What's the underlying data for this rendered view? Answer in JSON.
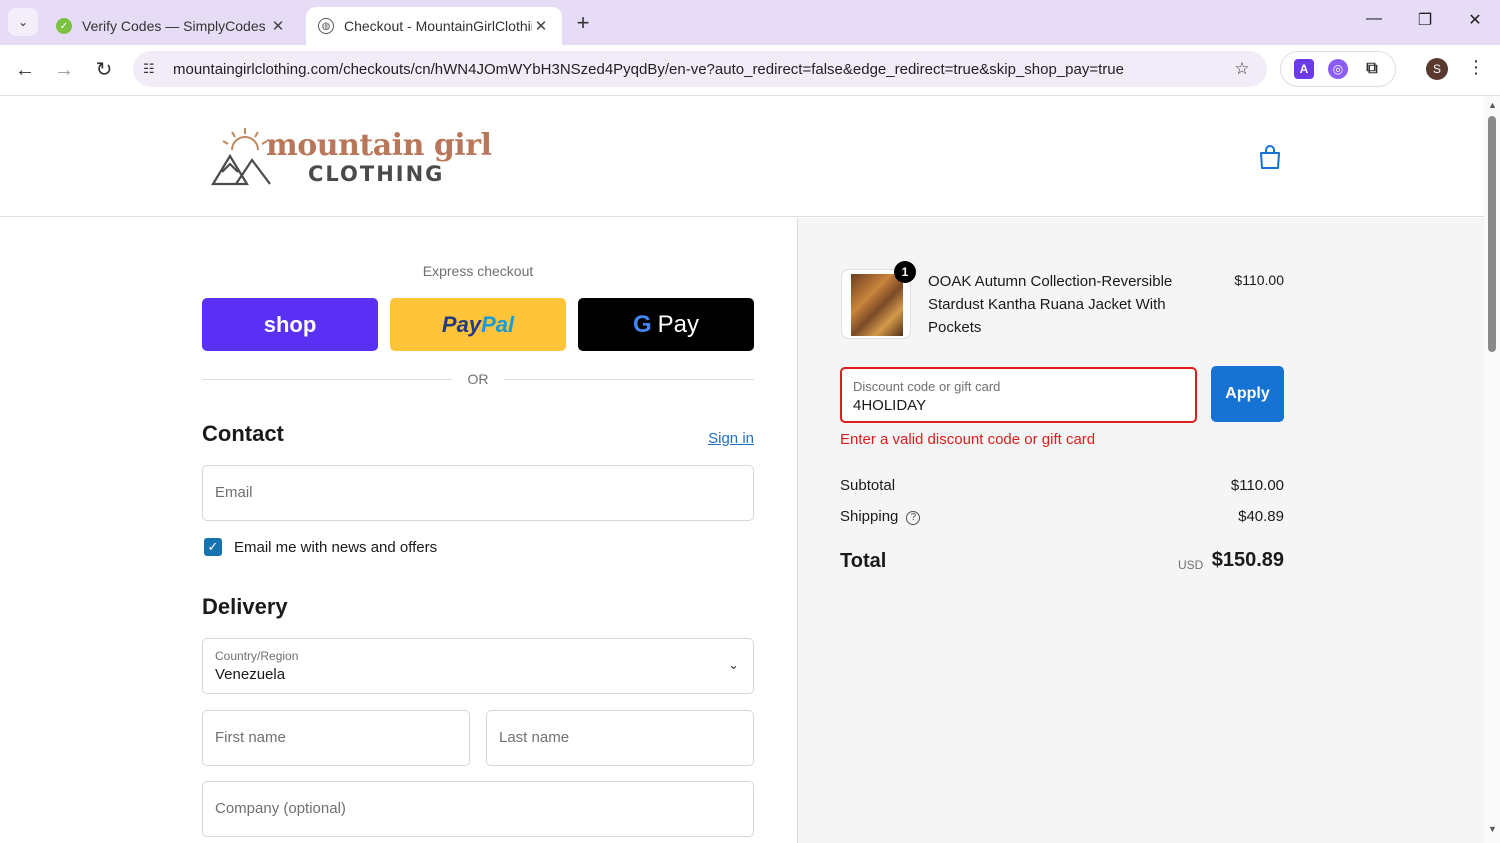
{
  "browser": {
    "tabs": [
      {
        "title": "Verify Codes — SimplyCodes",
        "active": false
      },
      {
        "title": "Checkout - MountainGirlClothing",
        "active": true
      }
    ],
    "url": "mountaingirlclothing.com/checkouts/cn/hWN4JOmWYbH3NSzed4PyqdBy/en-ve?auto_redirect=false&edge_redirect=true&skip_shop_pay=true",
    "profile_initial": "S",
    "new_tab_symbol": "+",
    "window_controls": {
      "minimize": "—",
      "restore": "❐",
      "close": "✕"
    }
  },
  "header": {
    "brand_line1": "mountain girl",
    "brand_line2": "CLOTHING"
  },
  "express": {
    "label": "Express checkout",
    "shop_label": "shop",
    "paypal_part1": "Pay",
    "paypal_part2": "Pal",
    "gpay_g": "G",
    "gpay_label": "Pay",
    "or_text": "OR"
  },
  "contact": {
    "title": "Contact",
    "signin": "Sign in",
    "email_placeholder": "Email",
    "newsletter_label": "Email me with news and offers",
    "newsletter_checked": true
  },
  "delivery": {
    "title": "Delivery",
    "country_label": "Country/Region",
    "country_value": "Venezuela",
    "first_name_placeholder": "First name",
    "last_name_placeholder": "Last name",
    "company_placeholder": "Company (optional)"
  },
  "summary": {
    "product": {
      "name": "OOAK Autumn Collection-Reversible Stardust Kantha Ruana Jacket With Pockets",
      "price": "$110.00",
      "quantity": "1"
    },
    "discount": {
      "label": "Discount code or gift card",
      "value": "4HOLIDAY",
      "apply_label": "Apply",
      "error": "Enter a valid discount code or gift card"
    },
    "subtotal_label": "Subtotal",
    "subtotal_value": "$110.00",
    "shipping_label": "Shipping",
    "shipping_value": "$40.89",
    "total_label": "Total",
    "currency": "USD",
    "total_value": "$150.89"
  },
  "colors": {
    "shop_purple": "#5a31f4",
    "paypal_yellow": "#ffc439",
    "apply_blue": "#1773d3",
    "error_red": "#dd1d1d",
    "brand_terracotta": "#b8765a"
  }
}
